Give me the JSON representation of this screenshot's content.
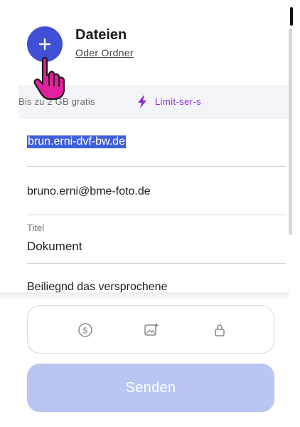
{
  "header": {
    "title": "Dateien",
    "folder_link": "Oder Ordner"
  },
  "limit": {
    "text": "Bis zu 2 GB gratis",
    "link": "Limit-ser-s",
    "icon": "bolt-icon"
  },
  "form": {
    "to_field": {
      "value": "brun.erni-dvf-bw.de",
      "selected": true
    },
    "from_field": {
      "value": "bruno.erni@bme-foto.de"
    },
    "title_field": {
      "label": "Titel",
      "value": "Dokument"
    },
    "message_field": {
      "value": "Beiliegnd das versprochene"
    }
  },
  "options": [
    {
      "icon": "dollar-coin-icon"
    },
    {
      "icon": "image-plus-icon"
    },
    {
      "icon": "lock-icon"
    }
  ],
  "send_button": {
    "label": "Senden",
    "state": "disabled"
  },
  "colors": {
    "accent": "#3f4fd6",
    "limit_link": "#8a2bd8",
    "send_disabled": "#b9c6f3",
    "selection": "#3f5fdc",
    "cursor": "#e0209c"
  }
}
